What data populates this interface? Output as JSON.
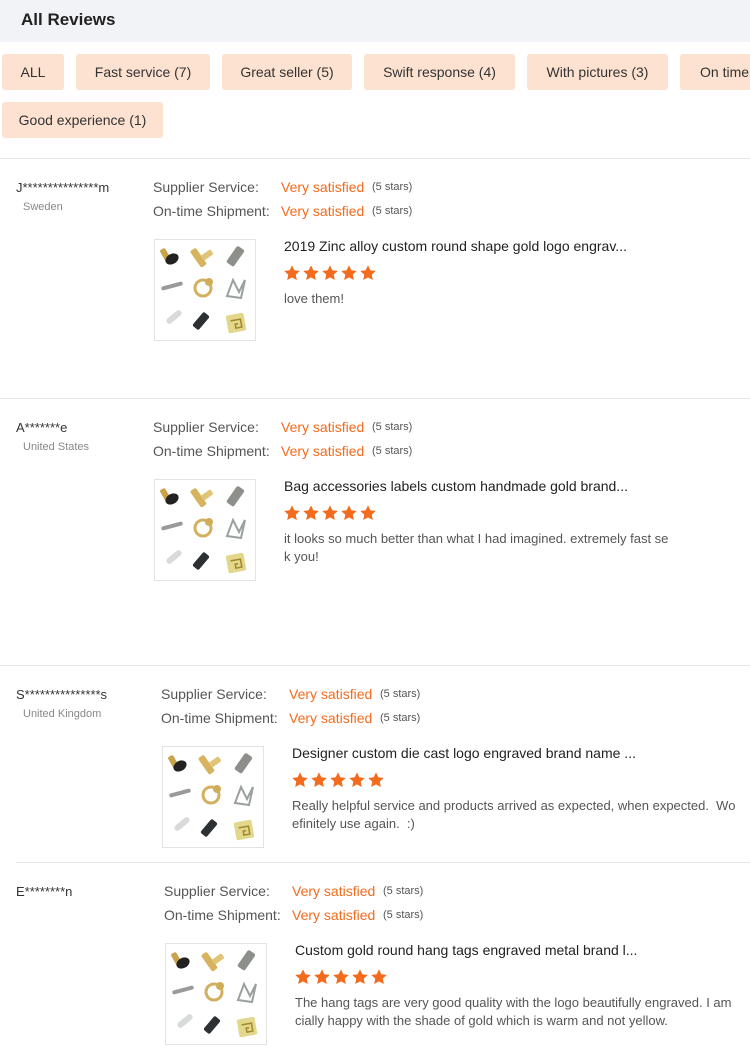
{
  "header": {
    "title": "All Reviews"
  },
  "filters": [
    {
      "label": "ALL"
    },
    {
      "label": "Fast service (7)"
    },
    {
      "label": "Great seller (5)"
    },
    {
      "label": "Swift response (4)"
    },
    {
      "label": "With pictures (3)"
    },
    {
      "label": "On time"
    },
    {
      "label": "Good experience (1)"
    }
  ],
  "labels": {
    "supplier_service": "Supplier Service:",
    "shipment": "On-time Shipment:"
  },
  "colors": {
    "accent": "#f36b1c",
    "chip_bg": "#fde2d1",
    "header_bg": "#f2f3f7"
  },
  "reviews": [
    {
      "name": "J***************m",
      "country": "Sweden",
      "service_value": "Very satisfied",
      "service_stars": "(5 stars)",
      "shipment_value": "Very satisfied",
      "shipment_stars": "(5 stars)",
      "product": "2019 Zinc alloy custom round shape gold logo engrav...",
      "rating": 5,
      "comment": "love them!"
    },
    {
      "name": "A*******e",
      "country": "United States",
      "service_value": "Very satisfied",
      "service_stars": "(5 stars)",
      "shipment_value": "Very satisfied",
      "shipment_stars": "(5 stars)",
      "product": "Bag accessories labels custom handmade gold brand...",
      "rating": 5,
      "comment": "it looks so much better than what I had imagined. extremely fast se\nk you!"
    },
    {
      "name": "S***************s",
      "country": "United Kingdom",
      "service_value": "Very satisfied",
      "service_stars": "(5 stars)",
      "shipment_value": "Very satisfied",
      "shipment_stars": "(5 stars)",
      "product": "Designer custom die cast logo engraved brand name ...",
      "rating": 5,
      "comment": "Really helpful service and products arrived as expected, when expected.  Wo\nefinitely use again.  :)"
    },
    {
      "name": "E********n",
      "country": "",
      "service_value": "Very satisfied",
      "service_stars": "(5 stars)",
      "shipment_value": "Very satisfied",
      "shipment_stars": "(5 stars)",
      "product": "Custom gold round hang tags engraved metal brand l...",
      "rating": 5,
      "comment": "The hang tags are very good quality with the logo beautifully engraved. I am\ncially happy with the shade of gold which is warm and not yellow."
    }
  ]
}
